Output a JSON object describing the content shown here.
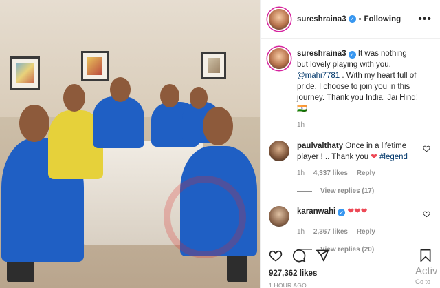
{
  "post": {
    "username": "sureshraina3",
    "verified_glyph": "✓",
    "separator": "•",
    "follow_status": "Following",
    "more_glyph": "•••"
  },
  "caption": {
    "username": "sureshraina3",
    "text_before_mention": " It was nothing but lovely playing with you, ",
    "mention": "@mahi7781",
    "text_after_mention": " . With my heart full of pride, I choose to join you in this journey. Thank you India. Jai Hind! 🇮🇳",
    "time": "1h"
  },
  "comments": [
    {
      "username": "paulvalthaty",
      "text": " Once in a lifetime player ! .. Thank you ",
      "heart": "❤",
      "hashtag": " #legend",
      "time": "1h",
      "likes": "4,337 likes",
      "reply": "Reply",
      "view_replies": "View replies (17)"
    },
    {
      "username": "karanwahi",
      "text": " ",
      "hearts": "❤❤❤",
      "time": "1h",
      "likes": "2,367 likes",
      "reply": "Reply",
      "view_replies": "View replies (20)"
    }
  ],
  "actions": {
    "like_icon": "heart-outline",
    "comment_icon": "speech-bubble",
    "share_icon": "paper-plane",
    "save_icon": "bookmark",
    "likes_count": "927,362 likes",
    "posted": "1 HOUR AGO"
  },
  "overlay": {
    "activate_line1": "Activ",
    "activate_line2": "Go to"
  },
  "colors": {
    "accent_link": "#00376b",
    "verified_blue": "#3897f0",
    "heart_red": "#ed4956",
    "muted": "#8e8e8e"
  }
}
